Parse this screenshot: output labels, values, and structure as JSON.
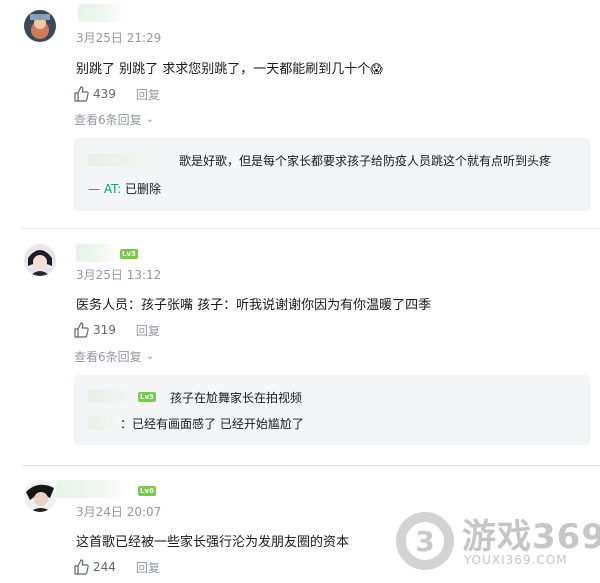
{
  "comments": [
    {
      "date": "3月25日 21:29",
      "text": "别跳了 别跳了 求求您别跳了，一天都能刷到几十个",
      "emoji": "😱",
      "likes": "439",
      "reply_label": "回复",
      "see_replies": "查看6条回复",
      "replies": [
        {
          "text": "歌是好歌，但是每个家长都要求孩子给防疫人员跳这个就有点听到头疼"
        },
        {
          "prefix": "— AT:",
          "text": "已删除"
        }
      ]
    },
    {
      "date": "3月25日 13:12",
      "level": "Lv3",
      "text": "医务人员：孩子张嘴 孩子：听我说谢谢你因为有你温暖了四季",
      "likes": "319",
      "reply_label": "回复",
      "see_replies": "查看6条回复",
      "replies": [
        {
          "level": "Lv3",
          "text": "孩子在尬舞家长在拍视频"
        },
        {
          "prefix": "：",
          "text": "已经有画面感了 已经开始尴尬了"
        }
      ]
    },
    {
      "date": "3月24日 20:07",
      "level": "Lv6",
      "text": "这首歌已经被一些家长强行沦为发朋友圈的资本",
      "likes": "244",
      "reply_label": "回复"
    }
  ],
  "watermark": {
    "digit": "3",
    "title": "游戏369",
    "url": "YOUXI369.COM"
  },
  "colors": {
    "accent_green": "#00a87a",
    "level_badge": "#79c94b",
    "muted_text": "#9499a0",
    "reply_bg": "#f4f5f7"
  }
}
